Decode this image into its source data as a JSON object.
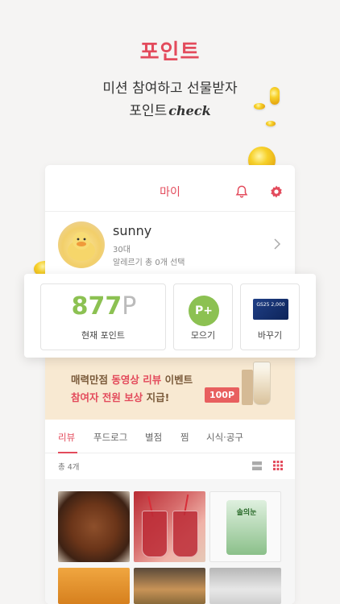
{
  "hero": {
    "title": "포인트",
    "subtitle_line1": "미션 참여하고 선물받자",
    "subtitle_line2_prefix": "포인트",
    "subtitle_line2_script": "check"
  },
  "card": {
    "header_title": "마이",
    "icons": {
      "notification": "bell-icon",
      "settings": "gear-icon"
    }
  },
  "profile": {
    "name": "sunny",
    "age_group": "30대",
    "allergy_text": "알레르기 총 0개 선택"
  },
  "points": {
    "value": "877",
    "unit": "P",
    "current_label": "현재 포인트",
    "collect_badge": "P+",
    "collect_label": "모으기",
    "exchange_label": "바꾸기",
    "giftcard_text": "GS25 2,000"
  },
  "banner": {
    "line1_prefix": "매력만점",
    "line1_highlight": "동영상 리뷰",
    "line1_suffix": "이벤트",
    "line2_highlight": "참여자 전원 보상",
    "line2_suffix": "지급!",
    "badge": "100P"
  },
  "tabs": [
    {
      "label": "리뷰",
      "active": true
    },
    {
      "label": "푸드로그",
      "active": false
    },
    {
      "label": "별점",
      "active": false
    },
    {
      "label": "찜",
      "active": false
    },
    {
      "label": "시식·공구",
      "active": false
    }
  ],
  "review_count": "총 4개",
  "photos": [
    {
      "label": "soup"
    },
    {
      "label": "drinks"
    },
    {
      "label": "솔의눈"
    },
    {
      "label": "jar"
    },
    {
      "label": "burger"
    },
    {
      "label": "desk"
    }
  ],
  "colors": {
    "accent": "#e34b5c",
    "points_green": "#8cc152",
    "banner_bg": "#f8e9d2",
    "coin_gold": "#f7d12a"
  }
}
